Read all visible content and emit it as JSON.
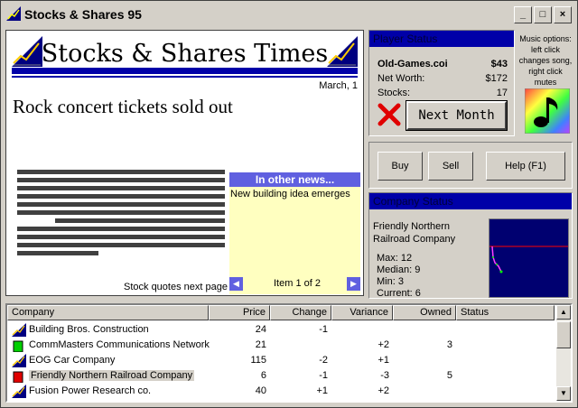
{
  "window": {
    "title": "Stocks & Shares 95"
  },
  "newspaper": {
    "masthead": "Stocks & Shares Times",
    "date": "March, 1",
    "headline": "Rock concert tickets sold out",
    "stock_note": "Stock quotes next page",
    "other_news": {
      "header": "In other news...",
      "item": "New building idea emerges",
      "pager": "Item 1 of 2"
    }
  },
  "player_status": {
    "header": "Player Status",
    "company": "Old-Games.coi",
    "cash": "$43",
    "net_worth_label": "Net Worth:",
    "net_worth": "$172",
    "stocks_label": "Stocks:",
    "stocks": "17",
    "next_month": "Next Month"
  },
  "music": {
    "text": "Music options: left click changes song, right click mutes"
  },
  "actions": {
    "buy": "Buy",
    "sell": "Sell",
    "help": "Help (F1)"
  },
  "company_status": {
    "header": "Company Status",
    "name": "Friendly Northern Railroad Company",
    "max": "Max: 12",
    "median": "Median: 9",
    "min": "Min: 3",
    "current": "Current: 6"
  },
  "table": {
    "columns": [
      "Company",
      "Price",
      "Change",
      "Variance",
      "Owned",
      "Status"
    ],
    "rows": [
      {
        "icon": "factory-icon",
        "company": "Building Bros. Construction",
        "price": "24",
        "change": "-1",
        "variance": "",
        "owned": "",
        "status": ""
      },
      {
        "icon": "green-bar-icon",
        "company": "CommMasters Communications Network",
        "price": "21",
        "change": "",
        "variance": "+2",
        "owned": "3",
        "status": ""
      },
      {
        "icon": "factory-icon",
        "company": "EOG Car Company",
        "price": "115",
        "change": "-2",
        "variance": "+1",
        "owned": "",
        "status": ""
      },
      {
        "icon": "red-bar-icon",
        "company": "Friendly Northern Railroad Company",
        "price": "6",
        "change": "-1",
        "variance": "-3",
        "owned": "5",
        "status": ""
      },
      {
        "icon": "factory-icon",
        "company": "Fusion Power Research co.",
        "price": "40",
        "change": "+1",
        "variance": "+2",
        "owned": "",
        "status": ""
      }
    ]
  },
  "colors": {
    "accent": "#0000a8",
    "news_bg": "#ffffc0",
    "news_header": "#6060e0",
    "chart_line": "#ff0000",
    "chart_series": "#00ff00"
  }
}
